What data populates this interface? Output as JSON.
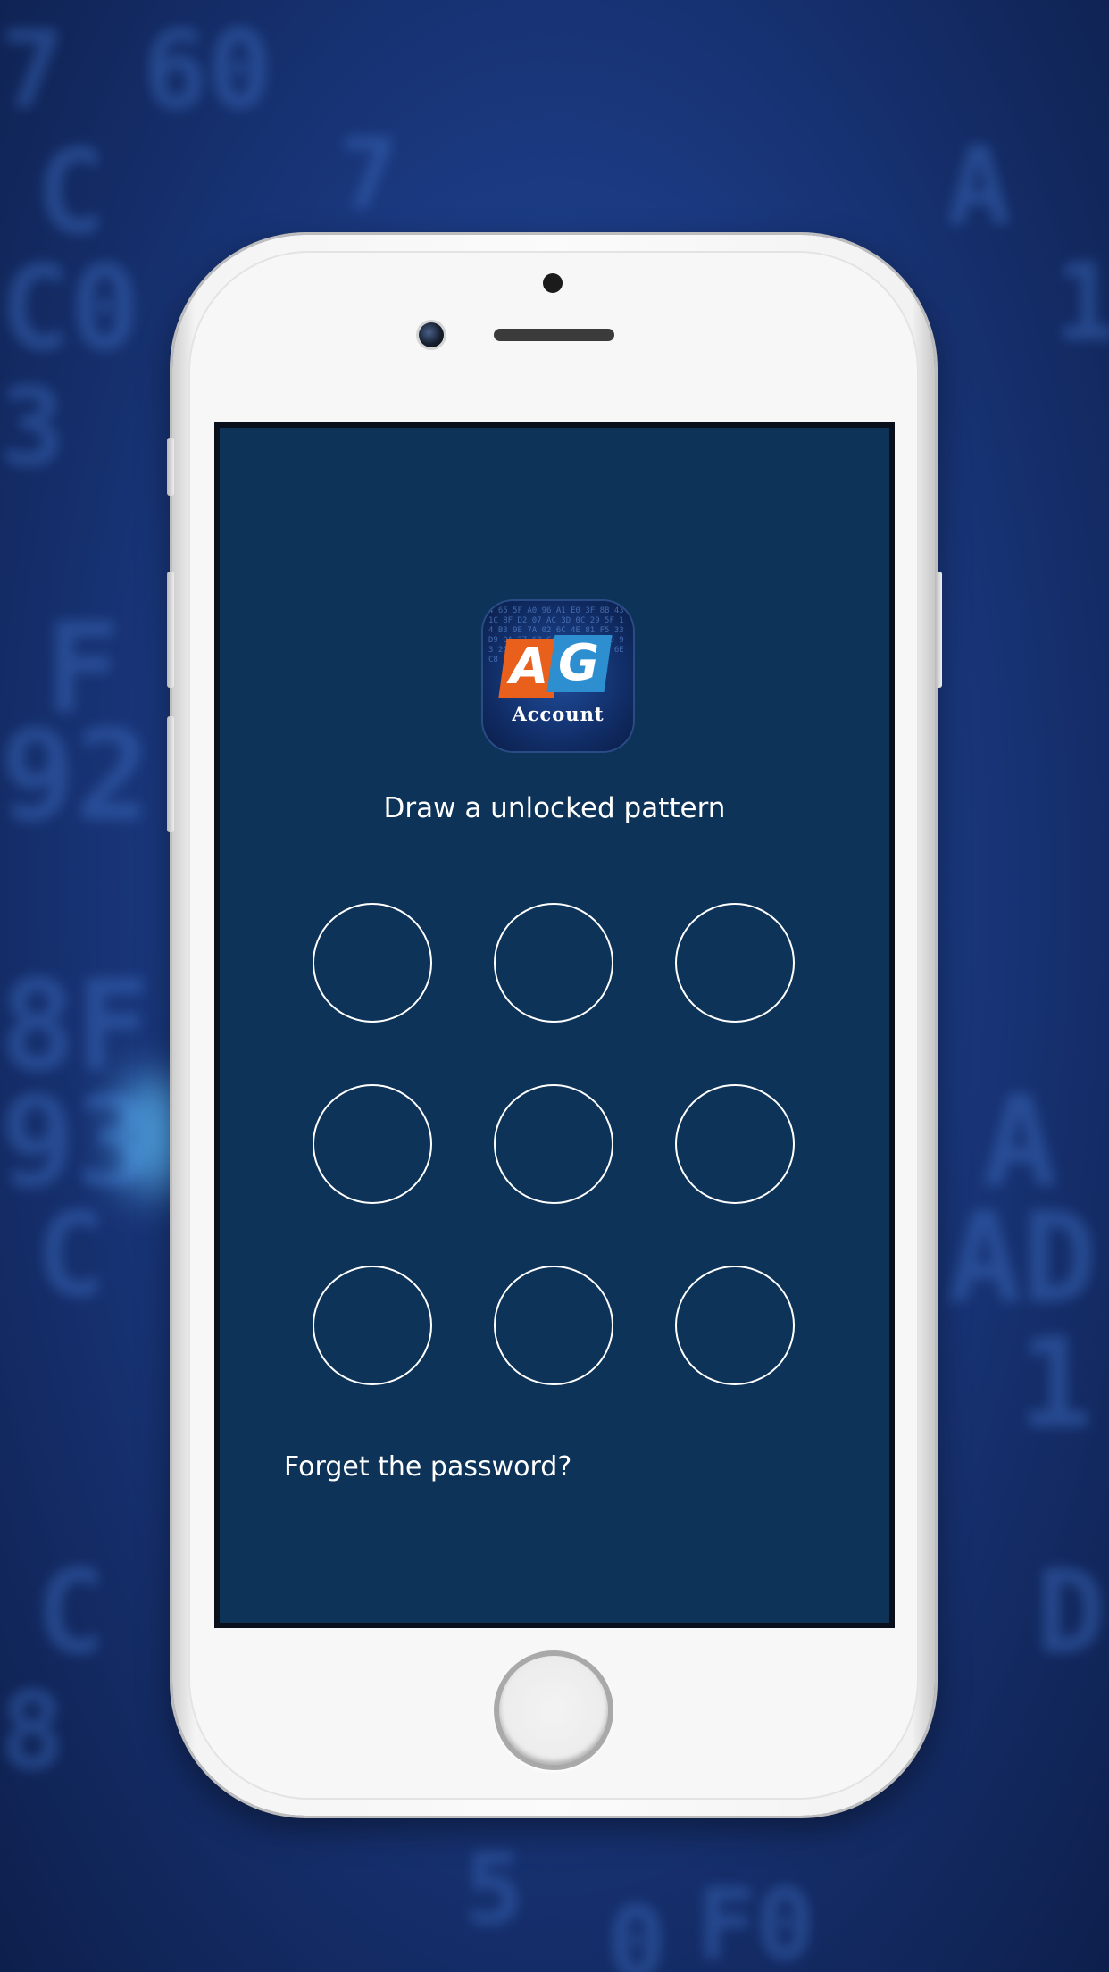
{
  "app": {
    "logo_letters": [
      "A",
      "G"
    ],
    "logo_word": "Account",
    "logo_matrix": "4 65 5F A0 96 A1 E0 3F 8B 43 1C 8F D2 07 AC 3D 0C 29 5F 14 B3 9E 7A 02 6C 4E 81 F5 33 D9 0A 27 6B C4 1E 88 5A F0 93 2C 7D A6 E1 40 3B 97 0F 6E C8 52 1A D4",
    "brand_colors": {
      "a_block": "#e8601c",
      "g_block": "#2d8fd0"
    }
  },
  "lock_screen": {
    "prompt": "Draw a unlocked pattern",
    "pattern_dots": [
      {
        "label": "dot-1"
      },
      {
        "label": "dot-2"
      },
      {
        "label": "dot-3"
      },
      {
        "label": "dot-4"
      },
      {
        "label": "dot-5"
      },
      {
        "label": "dot-6"
      },
      {
        "label": "dot-7"
      },
      {
        "label": "dot-8"
      },
      {
        "label": "dot-9"
      }
    ],
    "forgot_link": "Forget the password?"
  },
  "theme": {
    "screen_background": "#0e3359",
    "dot_stroke": "#ffffff",
    "text_color": "#ffffff"
  }
}
